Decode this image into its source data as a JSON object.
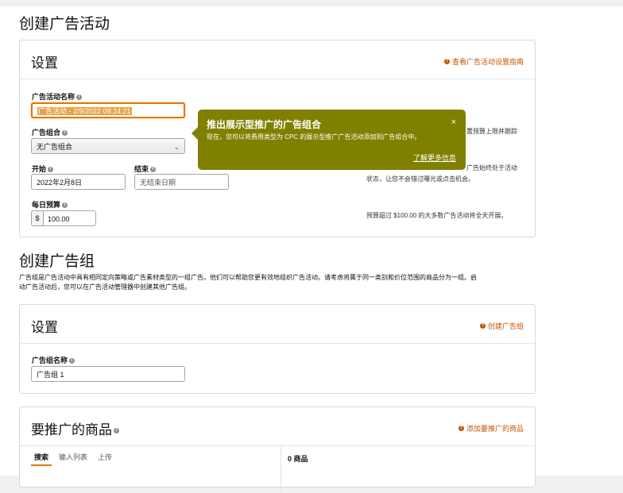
{
  "page_title": "创建广告活动",
  "settings": {
    "title": "设置",
    "guide_link": "查看广告活动设置指南",
    "campaign_name_label": "广告活动名称",
    "campaign_name_value": "广告活动 - 2/9/2022 09:24:21",
    "portfolio_label": "广告组合",
    "portfolio_value": "无广告组合",
    "start_label": "开始",
    "start_value": "2022年2月8日",
    "end_label": "结束",
    "end_value": "无结束日期",
    "budget_label": "每日预算",
    "budget_currency": "$",
    "budget_value": "100.00",
    "help_portfolio": "置预算上限并跟踪",
    "help_dates_1": "广告始终处于活动",
    "help_dates_2": "状态，让您不会错过曝光或点击机会。",
    "help_budget": "预算超过 $100.00 的大多数广告活动将全天开展。"
  },
  "popover": {
    "title": "推出展示型推广的广告组合",
    "body": "现在，您可以将费用类型为 CPC 的展示型推广广告活动添加到广告组合中。",
    "close": "×",
    "learn_more": "了解更多信息"
  },
  "ad_group": {
    "heading": "创建广告组",
    "description_line1": "广告组是广告活动中具有相同定向策略或广告素材类型的一组广告。他们可以帮助您更有效地组织广告活动。请考虑将属于同一类别和价位范围的商品分为一组。启",
    "description_line2": "动广告活动后，您可以在广告活动管理器中创建其他广告组。",
    "settings_title": "设置",
    "create_link": "创建广告组",
    "name_label": "广告组名称",
    "name_value": "广告组 1"
  },
  "products": {
    "title": "要推广的商品",
    "add_link": "添加要推广的商品",
    "tabs": [
      "搜索",
      "输入列表",
      "上传"
    ],
    "count": "0 商品"
  },
  "colors": {
    "accent_orange": "#c45500",
    "popover_bg": "#808000",
    "focus_border": "#e77600"
  }
}
